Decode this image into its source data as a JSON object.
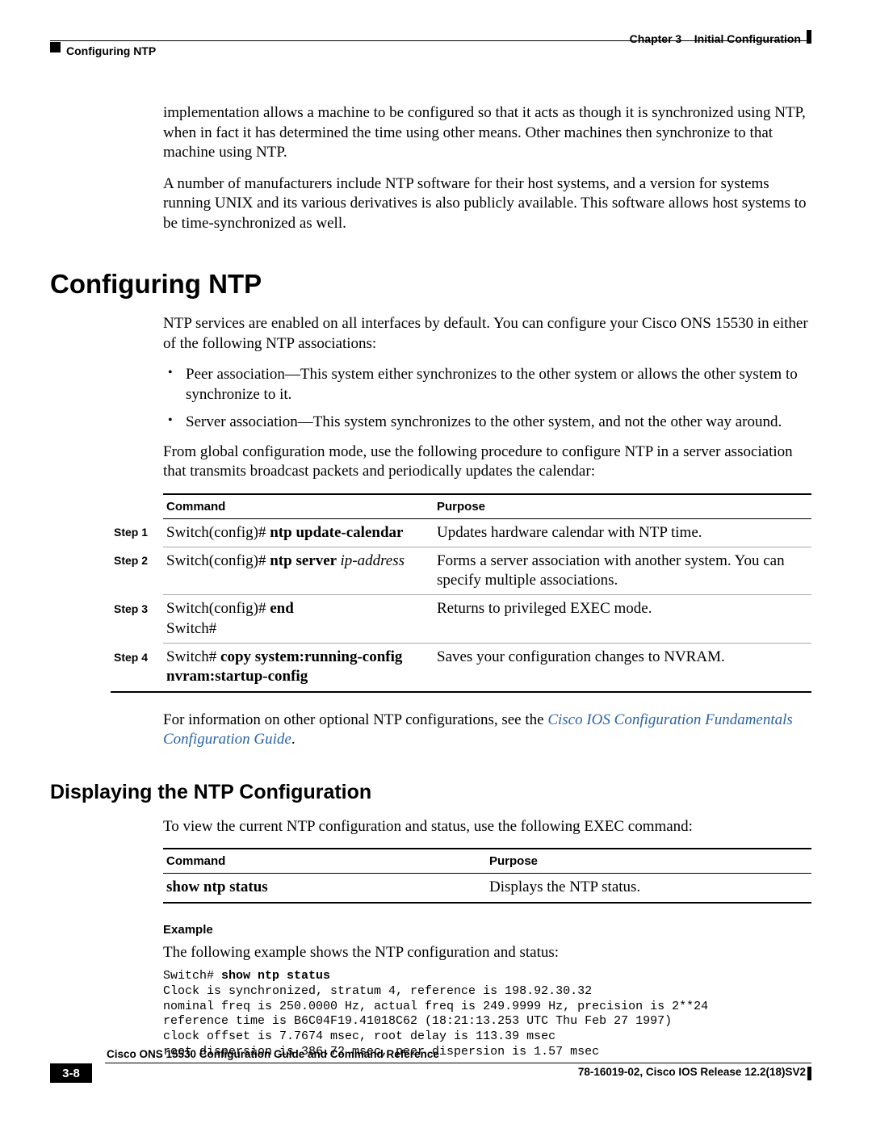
{
  "header": {
    "chapter_label": "Chapter 3",
    "chapter_title": "Initial Configuration",
    "section_title": "Configuring NTP"
  },
  "body": {
    "intro_para": "implementation allows a machine to be configured so that it acts as though it is synchronized using NTP, when in fact it has determined the time using other means. Other machines then synchronize to that machine using NTP.",
    "para2": "A number of manufacturers include NTP software for their host systems, and a version for systems running UNIX and its various derivatives is also publicly available. This software allows host systems to be time-synchronized as well.",
    "h1": "Configuring NTP",
    "p_after_h1": "NTP services are enabled on all interfaces by default. You can configure your Cisco ONS 15530 in either of the following NTP associations:",
    "bullets": [
      "Peer association—This system either synchronizes to the other system or allows the other system to synchronize to it.",
      "Server association—This system synchronizes to the other system, and not the other way around."
    ],
    "p_after_bullets": "From global configuration mode, use the following procedure to configure NTP in a server association that transmits broadcast packets and periodically updates the calendar:",
    "table1": {
      "head_cmd": "Command",
      "head_purpose": "Purpose",
      "rows": [
        {
          "step": "Step 1",
          "prompt": "Switch(config)# ",
          "bold": "ntp update-calendar",
          "italic": "",
          "extra": "",
          "purpose": "Updates hardware calendar with NTP time."
        },
        {
          "step": "Step 2",
          "prompt": "Switch(config)# ",
          "bold": "ntp server ",
          "italic": "ip-address",
          "extra": "",
          "purpose": "Forms a server association with another system. You can specify multiple associations."
        },
        {
          "step": "Step 3",
          "prompt": "Switch(config)# ",
          "bold": "end",
          "italic": "",
          "extra": "Switch#",
          "purpose": "Returns to privileged EXEC mode."
        },
        {
          "step": "Step 4",
          "prompt": "Switch# ",
          "bold": "copy system:running-config nvram:startup-config",
          "italic": "",
          "extra": "",
          "purpose": "Saves your configuration changes to NVRAM."
        }
      ]
    },
    "p_after_table1_a": "For information on other optional NTP configurations, see the ",
    "link_text": "Cisco IOS Configuration Fundamentals Configuration Guide",
    "p_after_table1_b": ".",
    "h2": "Displaying the NTP Configuration",
    "p_after_h2": "To view the current NTP configuration and status, use the following EXEC command:",
    "table2": {
      "head_cmd": "Command",
      "head_purpose": "Purpose",
      "cmd": "show ntp status",
      "purpose": "Displays the NTP status."
    },
    "example_head": "Example",
    "example_intro": "The following example shows the NTP configuration and status:",
    "example_prompt": "Switch# ",
    "example_cmd": "show ntp status",
    "example_output": "Clock is synchronized, stratum 4, reference is 198.92.30.32\nnominal freq is 250.0000 Hz, actual freq is 249.9999 Hz, precision is 2**24\nreference time is B6C04F19.41018C62 (18:21:13.253 UTC Thu Feb 27 1997)\nclock offset is 7.7674 msec, root delay is 113.39 msec\nroot dispersion is 386.72 msec, peer dispersion is 1.57 msec"
  },
  "footer": {
    "doc_title": "Cisco ONS 15530 Configuration Guide and Command Reference",
    "release": "78-16019-02, Cisco IOS Release 12.2(18)SV2",
    "page_num": "3-8"
  }
}
